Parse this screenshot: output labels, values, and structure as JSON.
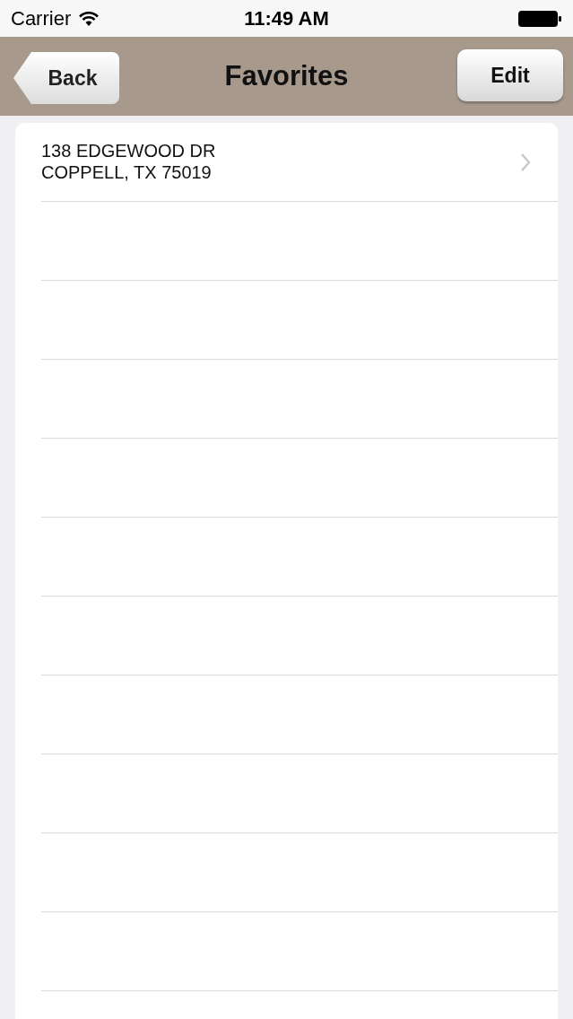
{
  "status_bar": {
    "carrier": "Carrier",
    "time": "11:49 AM"
  },
  "nav_bar": {
    "back_button": "Back",
    "title": "Favorites",
    "edit_button": "Edit"
  },
  "favorites": [
    {
      "lines": [
        "138 EDGEWOOD DR",
        "COPPELL, TX 75019"
      ]
    }
  ]
}
